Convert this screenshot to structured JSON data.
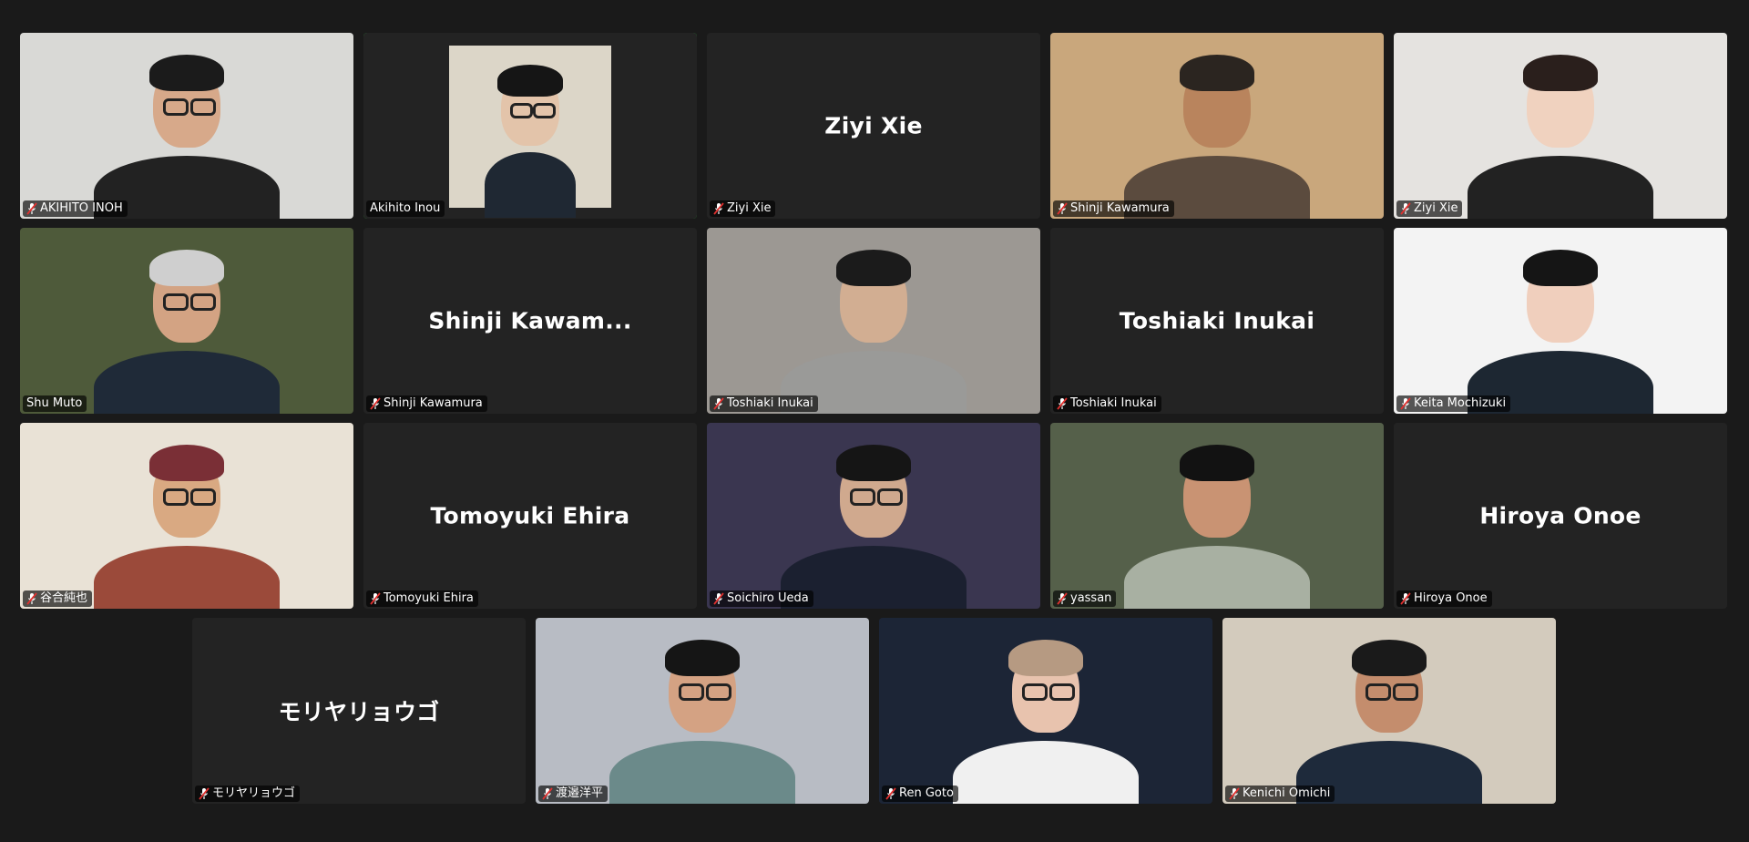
{
  "participants": [
    {
      "name": "AKIHITO INOH",
      "muted": true,
      "video": true,
      "bg": "#d9d9d6",
      "skin": "#d7a98a",
      "hair": "#1b1b1b",
      "shirt": "#222222",
      "glasses": true
    },
    {
      "name": "Akihito Inou",
      "muted": false,
      "video": "photo",
      "active": true,
      "bg": "#dcd6c8",
      "skin": "#e3c4aa",
      "hair": "#151515",
      "shirt": "#1f2833",
      "glasses": true
    },
    {
      "name": "Ziyi Xie",
      "muted": true,
      "video": false,
      "display_name": "Ziyi Xie"
    },
    {
      "name": "Shinji Kawamura",
      "muted": true,
      "video": true,
      "bg": "#c9a77c",
      "skin": "#b9845d",
      "hair": "#2b2520",
      "shirt": "#5b4b3e",
      "glasses": false
    },
    {
      "name": "Ziyi Xie",
      "muted": true,
      "video": true,
      "bg": "#e5e3e0",
      "skin": "#f0d2bf",
      "hair": "#2a1f1c",
      "shirt": "#222222",
      "glasses": false
    },
    {
      "name": "Shu Muto",
      "muted": false,
      "video": true,
      "bg": "#4e5a3a",
      "skin": "#d3a383",
      "hair": "#cfcfcf",
      "shirt": "#1f2a38",
      "glasses": true
    },
    {
      "name": "Shinji Kawamura",
      "muted": true,
      "video": false,
      "display_name": "Shinji Kawam..."
    },
    {
      "name": "Toshiaki Inukai",
      "muted": true,
      "video": true,
      "bg": "#9c9893",
      "skin": "#d2ae92",
      "hair": "#1b1b1b",
      "shirt": "#9a9a98",
      "glasses": false
    },
    {
      "name": "Toshiaki Inukai",
      "muted": true,
      "video": false,
      "display_name": "Toshiaki Inukai"
    },
    {
      "name": "Keita Mochizuki",
      "muted": true,
      "video": true,
      "bg": "#f3f3f3",
      "skin": "#f0cfbd",
      "hair": "#151515",
      "shirt": "#1d2732",
      "glasses": false
    },
    {
      "name": "谷合純也",
      "muted": true,
      "video": true,
      "bg": "#e9e2d6",
      "skin": "#d9a982",
      "hair": "#7a2f36",
      "shirt": "#9b4a3a",
      "glasses": true
    },
    {
      "name": "Tomoyuki Ehira",
      "muted": true,
      "video": false,
      "display_name": "Tomoyuki Ehira"
    },
    {
      "name": "Soichiro Ueda",
      "muted": true,
      "video": true,
      "bg": "#3a3650",
      "skin": "#d0a98e",
      "hair": "#151515",
      "shirt": "#1b2030",
      "glasses": true
    },
    {
      "name": "yassan",
      "muted": true,
      "video": true,
      "bg": "#55604a",
      "skin": "#c99373",
      "hair": "#121212",
      "shirt": "#a8b0a2",
      "glasses": false
    },
    {
      "name": "Hiroya Onoe",
      "muted": true,
      "video": false,
      "display_name": "Hiroya Onoe"
    },
    {
      "name": "モリヤリョウゴ",
      "muted": true,
      "video": false,
      "display_name": "モリヤリョウゴ"
    },
    {
      "name": "渡邉洋平",
      "muted": true,
      "video": true,
      "bg": "#b8bcc4",
      "skin": "#d4a283",
      "hair": "#151515",
      "shirt": "#6b8a8a",
      "glasses": true
    },
    {
      "name": "Ren Goto",
      "muted": true,
      "video": true,
      "bg": "#1c2536",
      "skin": "#e8c3ae",
      "hair": "#b69a82",
      "shirt": "#f0f0f0",
      "glasses": true
    },
    {
      "name": "Kenichi Omichi",
      "muted": true,
      "video": true,
      "bg": "#d3cbbd",
      "skin": "#c48d6d",
      "hair": "#1a1a1a",
      "shirt": "#1e2a3b",
      "glasses": true
    }
  ]
}
